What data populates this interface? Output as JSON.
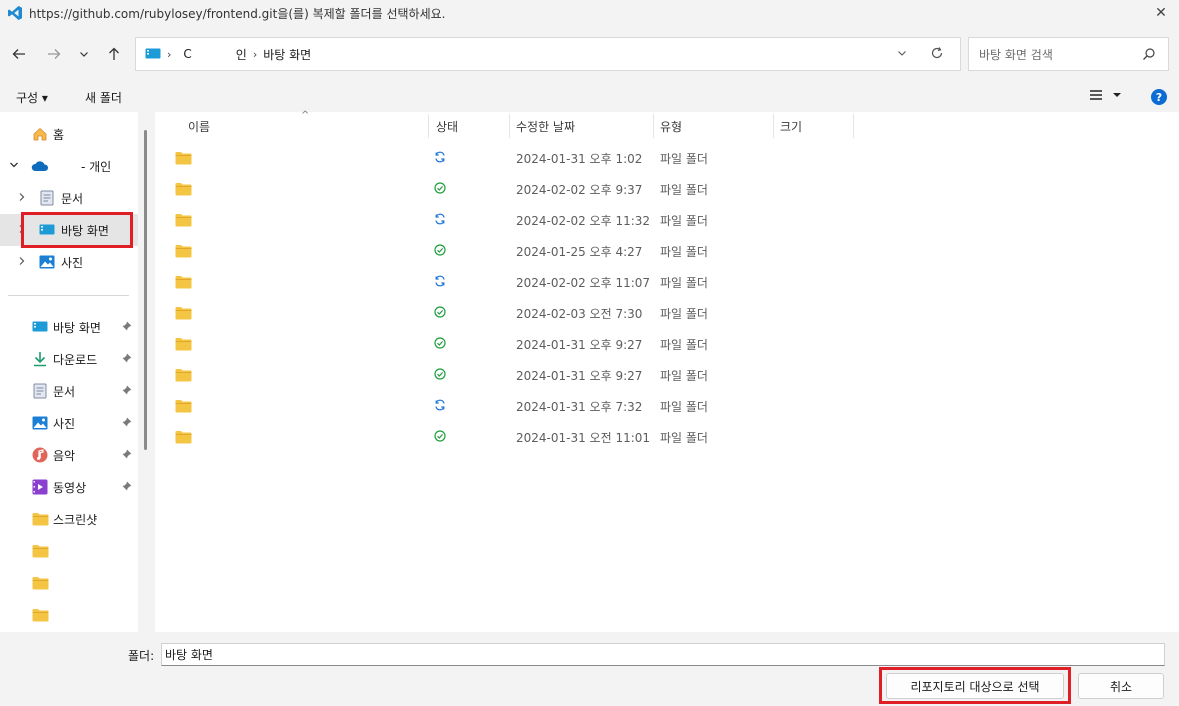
{
  "window": {
    "title": "https://github.com/rubylosey/frontend.git을(를) 복제할 폴더를 선택하세요.",
    "close_glyph": "✕"
  },
  "navbar": {
    "back_glyph": "←",
    "forward_glyph": "→",
    "recent_glyph": "⌄",
    "up_glyph": "↑",
    "breadcrumb": [
      "C",
      "인",
      "바탕 화면"
    ],
    "breadcrumb_sep": "›",
    "dropdown_glyph": "⌵",
    "search_placeholder": "바탕 화면 검색"
  },
  "commandbar": {
    "organize_label": "구성 ▾",
    "new_folder_label": "새 폴더",
    "help_label": "?"
  },
  "sidebar": {
    "home_label": "홈",
    "onedrive_label": "- 개인",
    "documents_label": "문서",
    "desktop_label": "바탕 화면",
    "pictures_label": "사진",
    "quick_access": [
      {
        "label": "바탕 화면",
        "icon": "desktop-icon"
      },
      {
        "label": "다운로드",
        "icon": "download-icon"
      },
      {
        "label": "문서",
        "icon": "document-icon"
      },
      {
        "label": "사진",
        "icon": "pictures-icon"
      },
      {
        "label": "음악",
        "icon": "music-icon"
      },
      {
        "label": "동영상",
        "icon": "video-icon"
      },
      {
        "label": "스크린샷",
        "icon": "folder-icon"
      }
    ],
    "chevron_right": "›",
    "chevron_down": "⌄",
    "pin_glyph": "📌"
  },
  "columns": {
    "name": "이름",
    "status": "상태",
    "modified": "수정한 날짜",
    "type": "유형",
    "size": "크기",
    "sort_glyph": "^"
  },
  "files": [
    {
      "status": "sync",
      "date": "2024-01-31 오후 1:02",
      "type": "파일 폴더"
    },
    {
      "status": "ok",
      "date": "2024-02-02 오후 9:37",
      "type": "파일 폴더"
    },
    {
      "status": "sync",
      "date": "2024-02-02 오후 11:32",
      "type": "파일 폴더"
    },
    {
      "status": "ok",
      "date": "2024-01-25 오후 4:27",
      "type": "파일 폴더"
    },
    {
      "status": "sync",
      "date": "2024-02-02 오후 11:07",
      "type": "파일 폴더"
    },
    {
      "status": "ok",
      "date": "2024-02-03 오전 7:30",
      "type": "파일 폴더"
    },
    {
      "status": "ok",
      "date": "2024-01-31 오후 9:27",
      "type": "파일 폴더"
    },
    {
      "status": "ok",
      "date": "2024-01-31 오후 9:27",
      "type": "파일 폴더"
    },
    {
      "status": "sync",
      "date": "2024-01-31 오후 7:32",
      "type": "파일 폴더"
    },
    {
      "status": "ok",
      "date": "2024-01-31 오전 11:01",
      "type": "파일 폴더"
    }
  ],
  "footer": {
    "folder_label": "폴더:",
    "folder_value": "바탕 화면",
    "select_button": "리포지토리 대상으로 선택",
    "cancel_button": "취소"
  },
  "colors": {
    "accent": "#0a6cd4",
    "highlight_red": "#e01e26",
    "folder_yellow": "#f4c443",
    "sync_blue": "#1a73d9",
    "ok_green": "#1e9e3e"
  }
}
